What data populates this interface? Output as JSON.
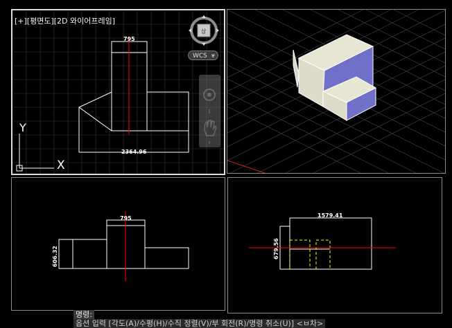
{
  "viewport_top": {
    "label": "[+][평면도][2D 와이어프레임]",
    "dim_width": "795",
    "dim_total": "2364.96",
    "ucs_x": "X",
    "ucs_y": "Y",
    "viewcube_face": "상",
    "wcs_label": "WCS"
  },
  "viewport_front": {
    "dim_width": "795",
    "dim_height": "606.32"
  },
  "viewport_right": {
    "dim_width": "1579.41",
    "dim_height": "679.56"
  },
  "command": {
    "label": "명령:",
    "prompt": "옵션 입력 [각도(A)/수평(H)/수직 정렬(V)/부 회전(R)/명령 취소(U)] <ㅂ차>"
  },
  "colors": {
    "background": "#000000",
    "grid": "#3a3a3a",
    "line": "#ffffff",
    "axis_red": "#ff0000",
    "hidden_yellow": "#ffff00",
    "face_cream": "#e6e6d2",
    "face_blue": "#7070c8"
  }
}
